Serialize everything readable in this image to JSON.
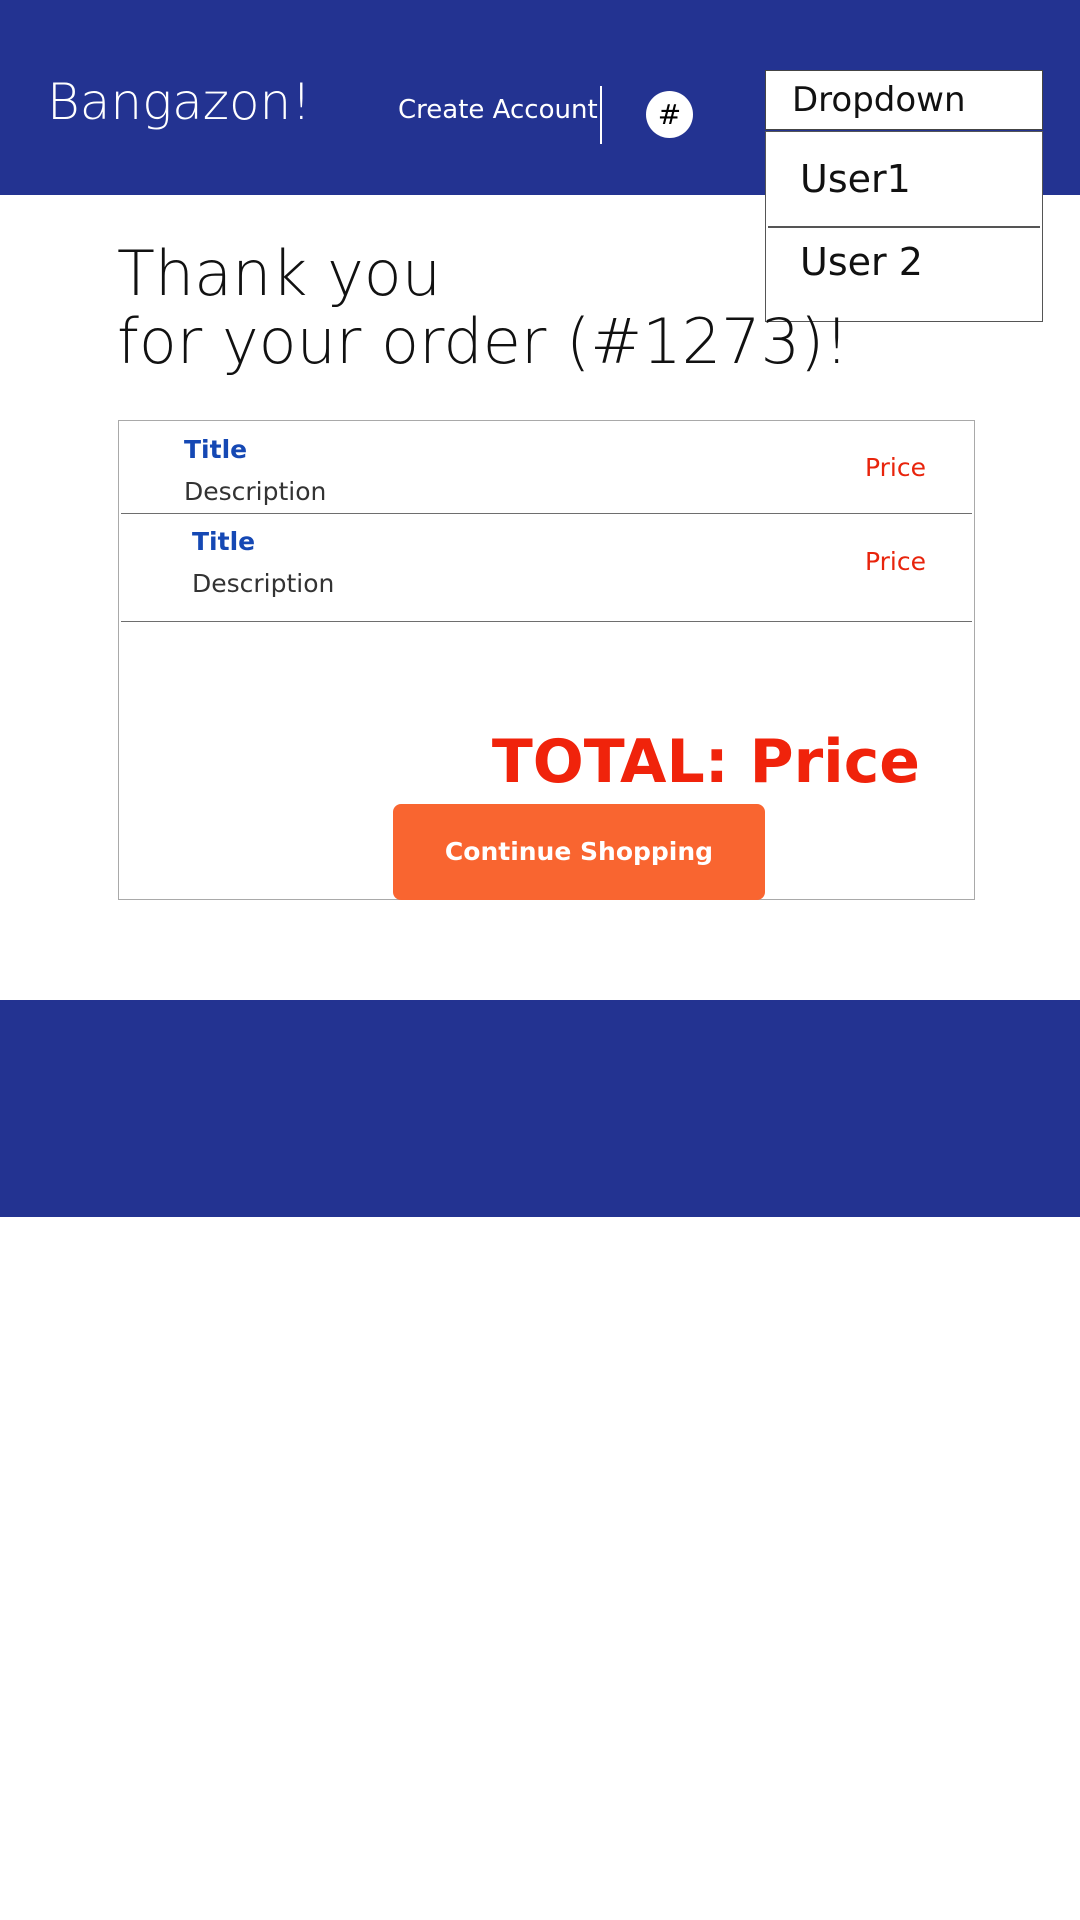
{
  "header": {
    "brand": "Bangazon!",
    "create_account_label": "Create Account",
    "badge_label": "#"
  },
  "dropdown": {
    "selected_label": "Dropdown",
    "options": [
      {
        "label": "User1"
      },
      {
        "label": "User 2"
      }
    ]
  },
  "main": {
    "heading_line1": "Thank you",
    "heading_line2": "for your order (#1273)!"
  },
  "order": {
    "items": [
      {
        "title": "Title",
        "description": "Description",
        "price": "Price"
      },
      {
        "title": "Title",
        "description": "Description",
        "price": "Price"
      }
    ],
    "total_label": "TOTAL: Price",
    "continue_label": "Continue Shopping"
  },
  "colors": {
    "brand_blue": "#233391",
    "title_blue": "#1548b4",
    "price_red": "#e8240c",
    "button_orange": "#f96530"
  }
}
